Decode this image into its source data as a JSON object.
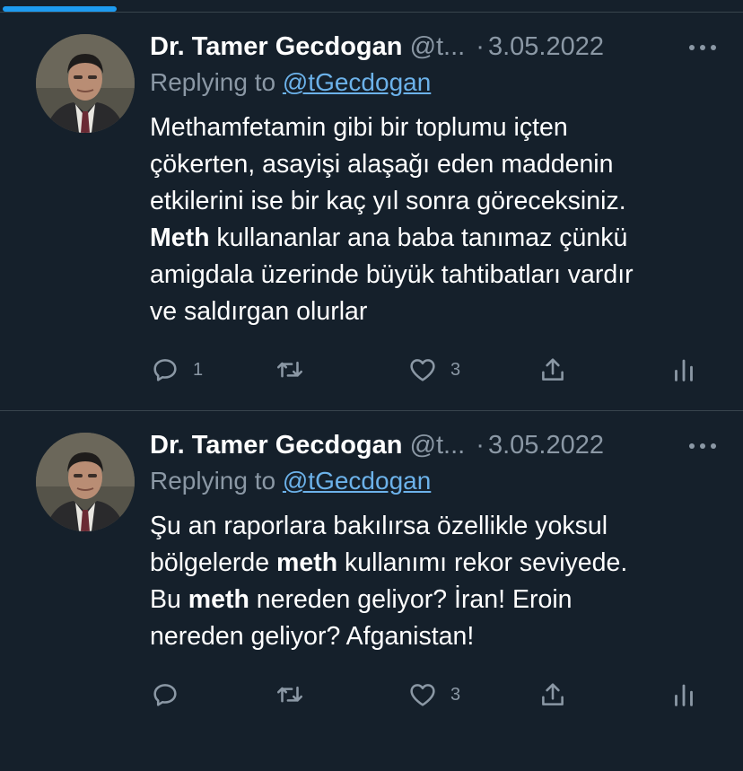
{
  "tweets": [
    {
      "display_name": "Dr. Tamer Gecdogan",
      "handle": "@t...",
      "separator": "·",
      "date": "3.05.2022",
      "replying_to_prefix": "Replying to",
      "replying_to_handle": "@tGecdogan",
      "body": [
        {
          "text": "Methamfetamin gibi bir toplumu içten\nçökerten, asayişi alaşağı eden maddenin\netkilerini ise bir kaç yıl sonra göreceksiniz.\n",
          "bold": false
        },
        {
          "text": "Meth",
          "bold": true
        },
        {
          "text": " kullananlar ana baba tanımaz çünkü\namigdala üzerinde büyük tahtibatları vardır\nve saldırgan olurlar",
          "bold": false
        }
      ],
      "actions": {
        "reply_count": "1",
        "retweet_count": "",
        "like_count": "3"
      }
    },
    {
      "display_name": "Dr. Tamer Gecdogan",
      "handle": "@t...",
      "separator": "·",
      "date": "3.05.2022",
      "replying_to_prefix": "Replying to",
      "replying_to_handle": "@tGecdogan",
      "body": [
        {
          "text": "Şu an raporlara bakılırsa özellikle yoksul\nbölgelerde ",
          "bold": false
        },
        {
          "text": "meth",
          "bold": true
        },
        {
          "text": " kullanımı rekor seviyede.\nBu ",
          "bold": false
        },
        {
          "text": "meth",
          "bold": true
        },
        {
          "text": " nereden geliyor? İran! Eroin\nnereden geliyor? Afganistan!",
          "bold": false
        }
      ],
      "actions": {
        "reply_count": "",
        "retweet_count": "",
        "like_count": "3"
      }
    }
  ],
  "icons": {
    "more": "more-icon",
    "reply": "reply-icon",
    "retweet": "retweet-icon",
    "like": "like-icon",
    "share": "share-icon",
    "analytics": "analytics-icon"
  },
  "colors": {
    "background": "#15202b",
    "text_primary": "#ffffff",
    "text_secondary": "#8b98a5",
    "link": "#6cb2ea",
    "accent": "#1d9bf0",
    "divider": "#38444d"
  }
}
